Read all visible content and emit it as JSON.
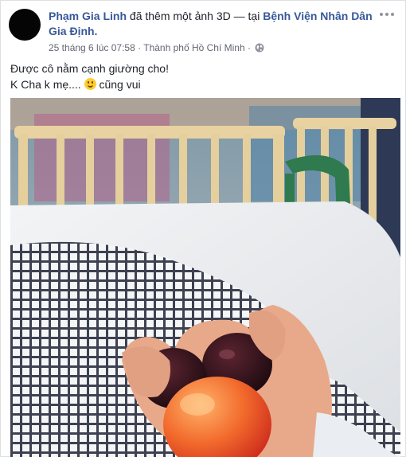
{
  "post": {
    "author": "Phạm Gia Linh",
    "action": "đã thêm một ảnh 3D — tại",
    "location": "Bệnh Viện Nhân Dân Gia Định.",
    "timestamp": "25 tháng 6 lúc 07:58",
    "separator": "·",
    "place": "Thành phố Hồ Chí Minh",
    "separator2": "·",
    "privacy_icon": "globe-icon",
    "text_line1": "Được cô nằm cạnh giường cho!",
    "text_line2_before": "K Cha k mẹ....",
    "text_line2_after": "cũng vui",
    "emoji": "slightly-smiling-face-icon"
  },
  "colors": {
    "link": "#385898",
    "meta": "#616770",
    "text": "#1d2129"
  }
}
